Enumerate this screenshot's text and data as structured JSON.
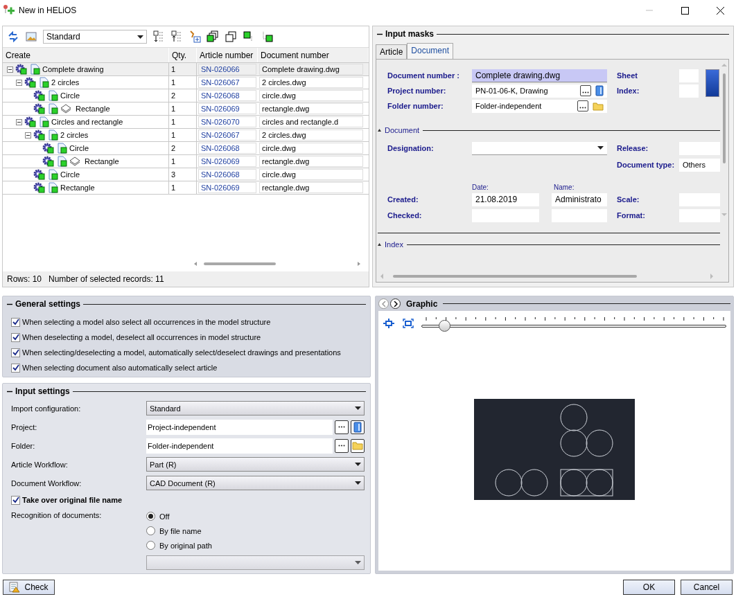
{
  "window": {
    "title": "New in HELiOS"
  },
  "structure": {
    "view": "Standard",
    "columns": [
      "Create",
      "Qty.",
      "Article number",
      "Document number"
    ],
    "rows": [
      {
        "name": "Complete drawing",
        "qty": "1",
        "article_number": "SN-026066",
        "document_number": "Complete drawing.dwg",
        "layer": false,
        "selected": true,
        "expanded": true,
        "children": [
          {
            "name": "2 circles",
            "qty": "1",
            "article_number": "SN-026067",
            "document_number": "2 circles.dwg",
            "layer": false,
            "selected": false,
            "expanded": true,
            "children": [
              {
                "name": "Circle",
                "qty": "2",
                "article_number": "SN-026068",
                "document_number": "circle.dwg",
                "layer": false,
                "selected": false
              },
              {
                "name": "Rectangle",
                "qty": "1",
                "article_number": "SN-026069",
                "document_number": "rectangle.dwg",
                "layer": true,
                "selected": false
              }
            ]
          },
          {
            "name": "Circles and rectangle",
            "qty": "1",
            "article_number": "SN-026070",
            "document_number": "circles and rectangle.d",
            "layer": false,
            "selected": false,
            "expanded": true,
            "children": [
              {
                "name": "2 circles",
                "qty": "1",
                "article_number": "SN-026067",
                "document_number": "2 circles.dwg",
                "layer": false,
                "selected": false,
                "expanded": true,
                "children": [
                  {
                    "name": "Circle",
                    "qty": "2",
                    "article_number": "SN-026068",
                    "document_number": "circle.dwg",
                    "layer": false,
                    "selected": false
                  },
                  {
                    "name": "Rectangle",
                    "qty": "1",
                    "article_number": "SN-026069",
                    "document_number": "rectangle.dwg",
                    "layer": true,
                    "selected": false
                  }
                ]
              },
              {
                "name": "Circle",
                "qty": "3",
                "article_number": "SN-026068",
                "document_number": "circle.dwg",
                "layer": false,
                "selected": false
              },
              {
                "name": "Rectangle",
                "qty": "1",
                "article_number": "SN-026069",
                "document_number": "rectangle.dwg",
                "layer": false,
                "selected": false
              }
            ]
          }
        ]
      }
    ],
    "status": [
      "Rows: 10",
      "Number of selected records: 11"
    ]
  },
  "input_masks": {
    "title": "Input masks",
    "tabs": [
      {
        "label": "Article",
        "selected": false
      },
      {
        "label": "Document",
        "selected": true
      }
    ],
    "document_number": {
      "label": "Document number :",
      "value": "Complete drawing.dwg"
    },
    "project_number": {
      "label": "Project number:",
      "value": "PN-01-06-K, Drawing"
    },
    "folder_number": {
      "label": "Folder number:",
      "value": "Folder-independent"
    },
    "sheet": {
      "label": "Sheet"
    },
    "index": {
      "label": "Index:"
    },
    "document_section": {
      "title": "Document",
      "designation": {
        "label": "Designation:"
      },
      "release": {
        "label": "Release:"
      },
      "document_type": {
        "label": "Document type:",
        "value": "Others"
      },
      "date_header": "Date:",
      "name_header": "Name:",
      "created": {
        "label": "Created:",
        "date": "21.08.2019",
        "name": "Administrato"
      },
      "checked": {
        "label": "Checked:"
      },
      "scale": {
        "label": "Scale:"
      },
      "format": {
        "label": "Format:"
      }
    },
    "index_section": {
      "title": "Index"
    }
  },
  "general_settings": {
    "title": "General settings",
    "options": [
      {
        "label": "When selecting a model also select all occurrences in the model structure",
        "checked": true
      },
      {
        "label": "When deselecting a model, deselect all occurrences in model structure",
        "checked": true
      },
      {
        "label": "When selecting/deselecting a model, automatically select/deselect drawings and presentations",
        "checked": true
      },
      {
        "label": "When selecting document also automatically select article",
        "checked": true
      }
    ]
  },
  "input_settings": {
    "title": "Input settings",
    "import_configuration": {
      "label": "Import configuration:",
      "value": "Standard"
    },
    "project": {
      "label": "Project:",
      "value": "Project-independent"
    },
    "folder": {
      "label": "Folder:",
      "value": "Folder-independent"
    },
    "article_workflow": {
      "label": "Article Workflow:",
      "value": "Part (R)"
    },
    "document_workflow": {
      "label": "Document Workflow:",
      "value": "CAD Document (R)"
    },
    "take_over_file_name": {
      "label": "Take over original file name",
      "checked": true
    },
    "recognition": {
      "label": "Recognition of documents:",
      "options": [
        {
          "label": "Off",
          "selected": true
        },
        {
          "label": "By file name",
          "selected": false
        },
        {
          "label": "By original path",
          "selected": false
        }
      ]
    }
  },
  "graphic": {
    "title": "Graphic",
    "zoom": {
      "level": 0.075
    }
  },
  "buttons": {
    "check": "Check",
    "ok": "OK",
    "cancel": "Cancel"
  }
}
